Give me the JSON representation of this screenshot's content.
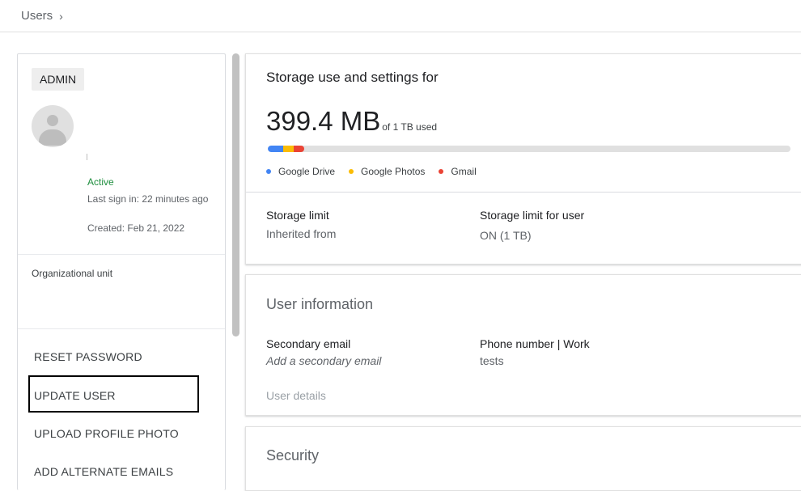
{
  "breadcrumb": {
    "label": "Users",
    "separator": "›"
  },
  "user_panel": {
    "role": "ADMIN",
    "status": "Active",
    "last_sign_in": "Last sign in: 22 minutes ago",
    "created": "Created: Feb 21, 2022",
    "org_unit_label": "Organizational unit",
    "actions": [
      "RESET PASSWORD",
      "UPDATE USER",
      "UPLOAD PROFILE PHOTO",
      "ADD ALTERNATE EMAILS"
    ]
  },
  "storage": {
    "title": "Storage use and settings for",
    "amount": "399.4 MB",
    "of_total": "of 1 TB used",
    "usage_segments": [
      {
        "name": "Google Drive",
        "color": "#4285f4",
        "fraction": 0.029
      },
      {
        "name": "Google Photos",
        "color": "#fbbc04",
        "fraction": 0.02
      },
      {
        "name": "Gmail",
        "color": "#ea4335",
        "fraction": 0.02
      }
    ],
    "legend": [
      "Google Drive",
      "Google Photos",
      "Gmail"
    ],
    "limit_label": "Storage limit",
    "limit_value": "Inherited from",
    "user_limit_label": "Storage limit for user",
    "user_limit_value": "ON (1 TB)"
  },
  "user_info": {
    "title": "User information",
    "secondary_email_label": "Secondary email",
    "secondary_email_placeholder": "Add a secondary email",
    "phone_label": "Phone number | Work",
    "phone_value": "tests",
    "details_link": "User details"
  },
  "security": {
    "title": "Security"
  },
  "colors": {
    "active": "#1e8e3e",
    "drive": "#4285f4",
    "photos": "#fbbc04",
    "gmail": "#ea4335"
  }
}
